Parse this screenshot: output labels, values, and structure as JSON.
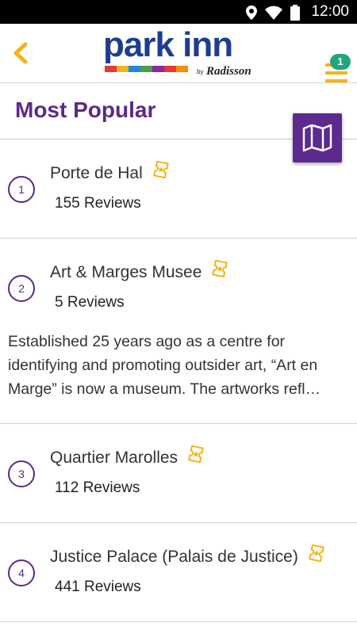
{
  "status_bar": {
    "time": "12:00"
  },
  "header": {
    "logo": {
      "brand": "park inn",
      "by": "by",
      "partner": "Radisson"
    },
    "notification_count": "1"
  },
  "section": {
    "title": "Most Popular"
  },
  "attractions": [
    {
      "number": "1",
      "name": "Porte de Hal",
      "reviews": "155 Reviews"
    },
    {
      "number": "2",
      "name": "Art & Marges Musee",
      "reviews": "5 Reviews",
      "description_lines": [
        "Established 25 years ago as a centre for",
        "identifying and promoting outsider art, “Art en",
        "Marge” is now a museum. The artworks refl…"
      ]
    },
    {
      "number": "3",
      "name": "Quartier Marolles",
      "reviews": "112 Reviews"
    },
    {
      "number": "4",
      "name": "Justice Palace (Palais de Justice)",
      "reviews": "441 Reviews"
    }
  ],
  "colors": {
    "accent": "#5a2a8b",
    "icon_yellow": "#f5b31b",
    "badge": "#22a57d",
    "brand_blue": "#1d3e8e"
  },
  "icons": {
    "back": "chevron-left-icon",
    "menu": "hamburger-menu-icon",
    "map": "map-icon",
    "ticket": "ticket-icon"
  }
}
